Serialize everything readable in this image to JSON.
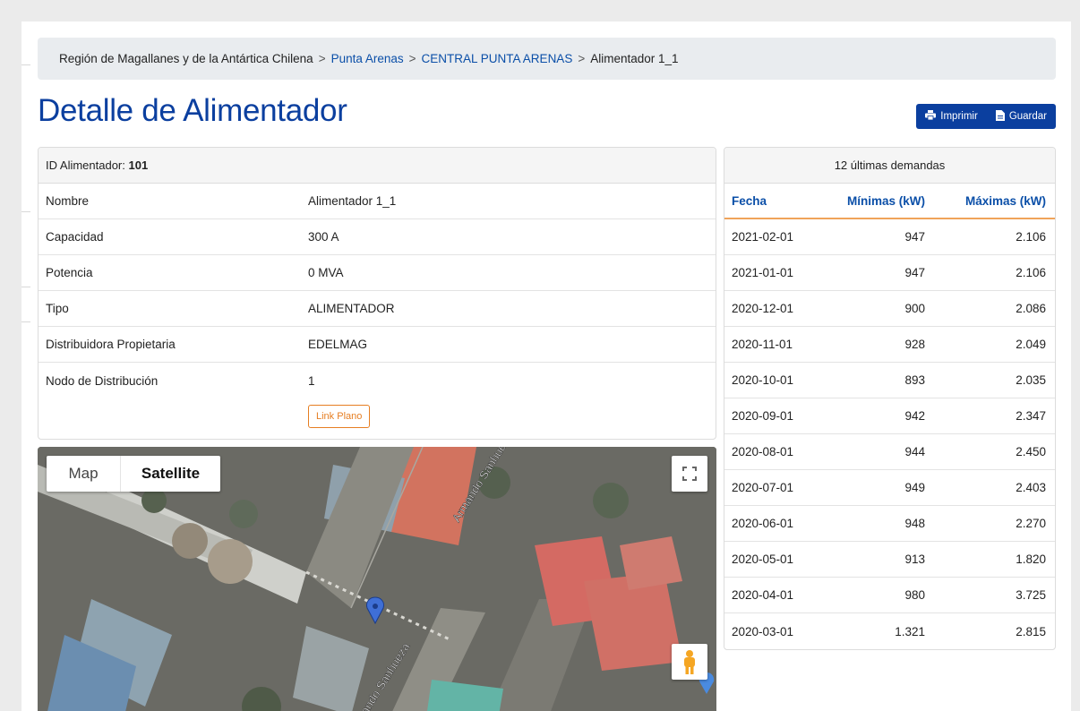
{
  "breadcrumb": {
    "region": "Región de Magallanes y de la Antártica Chilena",
    "comuna": "Punta Arenas",
    "central": "CENTRAL PUNTA ARENAS",
    "current": "Alimentador 1_1",
    "separator": ">"
  },
  "page": {
    "title": "Detalle de Alimentador"
  },
  "actions": {
    "print_label": "Imprimir",
    "save_label": "Guardar"
  },
  "info": {
    "id_label": "ID Alimentador:",
    "id_value": "101",
    "rows": [
      {
        "label": "Nombre",
        "value": "Alimentador 1_1"
      },
      {
        "label": "Capacidad",
        "value": "300 A"
      },
      {
        "label": "Potencia",
        "value": "0 MVA"
      },
      {
        "label": "Tipo",
        "value": "ALIMENTADOR"
      },
      {
        "label": "Distribuidora Propietaria",
        "value": "EDELMAG"
      },
      {
        "label": "Nodo de Distribución",
        "value": "1"
      }
    ],
    "link_plano_label": "Link Plano"
  },
  "map": {
    "map_label": "Map",
    "satellite_label": "Satellite",
    "selected_type": "Satellite",
    "street_labels": [
      "Armando Sanhueza",
      "Armando Sanhueza"
    ]
  },
  "demands": {
    "title": "12 últimas demandas",
    "columns": {
      "date": "Fecha",
      "min": "Mínimas (kW)",
      "max": "Máximas (kW)"
    },
    "rows": [
      {
        "date": "2021-02-01",
        "min": "947",
        "max": "2.106"
      },
      {
        "date": "2021-01-01",
        "min": "947",
        "max": "2.106"
      },
      {
        "date": "2020-12-01",
        "min": "900",
        "max": "2.086"
      },
      {
        "date": "2020-11-01",
        "min": "928",
        "max": "2.049"
      },
      {
        "date": "2020-10-01",
        "min": "893",
        "max": "2.035"
      },
      {
        "date": "2020-09-01",
        "min": "942",
        "max": "2.347"
      },
      {
        "date": "2020-08-01",
        "min": "944",
        "max": "2.450"
      },
      {
        "date": "2020-07-01",
        "min": "949",
        "max": "2.403"
      },
      {
        "date": "2020-06-01",
        "min": "948",
        "max": "2.270"
      },
      {
        "date": "2020-05-01",
        "min": "913",
        "max": "1.820"
      },
      {
        "date": "2020-04-01",
        "min": "980",
        "max": "3.725"
      },
      {
        "date": "2020-03-01",
        "min": "1.321",
        "max": "2.815"
      }
    ]
  },
  "colors": {
    "brand_blue": "#0b3f9f",
    "link_blue": "#0b4fa8",
    "accent_orange": "#e67e22",
    "marker_blue": "#3f6fd6"
  },
  "icons": {
    "print": "printer-icon",
    "save": "save-file-icon",
    "fullscreen": "fullscreen-icon",
    "pegman": "pegman-icon",
    "marker": "map-marker-icon"
  }
}
